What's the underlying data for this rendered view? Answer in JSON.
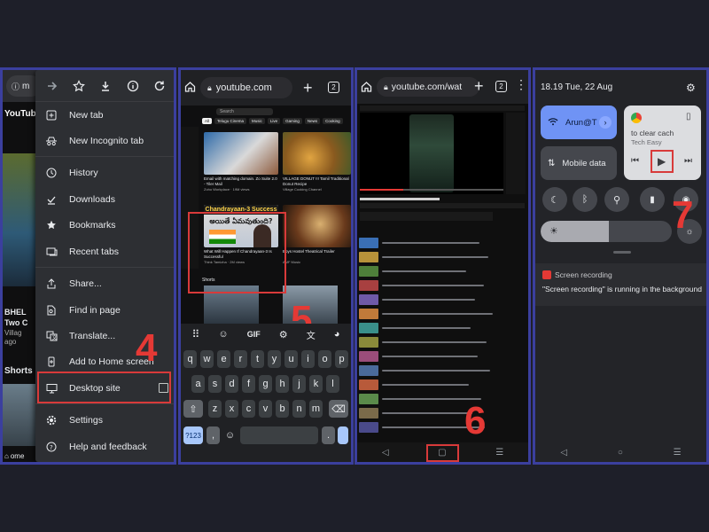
{
  "panel1": {
    "peek_text": {
      "url_fragment": "m",
      "yt": "YouTube",
      "bhel": "BHEL",
      "two": "Two C",
      "village": "Villag",
      "ago": "ago",
      "shorts": "Shorts",
      "home": "ome"
    },
    "menu_items": [
      {
        "label": "New tab",
        "icon": "new-tab-icon"
      },
      {
        "label": "New Incognito tab",
        "icon": "incognito-icon"
      },
      {
        "label": "History",
        "icon": "history-icon"
      },
      {
        "label": "Downloads",
        "icon": "download-done-icon"
      },
      {
        "label": "Bookmarks",
        "icon": "star-icon"
      },
      {
        "label": "Recent tabs",
        "icon": "recent-tabs-icon"
      },
      {
        "label": "Share...",
        "icon": "share-icon"
      },
      {
        "label": "Find in page",
        "icon": "find-in-page-icon"
      },
      {
        "label": "Translate...",
        "icon": "translate-icon"
      },
      {
        "label": "Add to Home screen",
        "icon": "add-to-home-icon"
      },
      {
        "label": "Desktop site",
        "icon": "desktop-icon"
      },
      {
        "label": "Settings",
        "icon": "settings-icon"
      },
      {
        "label": "Help and feedback",
        "icon": "help-icon"
      }
    ],
    "step": "4"
  },
  "panel2": {
    "url": "youtube.com",
    "tab_count": "2",
    "search_placeholder": "Search",
    "chips": [
      "All",
      "Telugu Cinema",
      "Music",
      "Live",
      "Gaming",
      "News",
      "Cooking"
    ],
    "video1_title": "Email with matching domain. Zo Suite 2.0 - Tiler Mail",
    "video1_meta": "Zoho Workplace · 19M views",
    "video2_title": "VILLAGE DONUT !!! Tamil Traditional Donut Recipe",
    "video2_meta": "Village Cooking Channel",
    "highlight_title": "Chandrayaan-3 Success",
    "highlight_telugu": "అయితే ఏమవుతుంది?",
    "highlight_video_title": "What Will Happen If Chandrayaan-3 Is Successful",
    "highlight_meta": "Think Tamizha · 2M views",
    "video4_title": "Boys Hostel Theatrical Trailer",
    "video4_meta": "AMF Music",
    "shorts_label": "Shorts",
    "keyboard_row1": [
      "q",
      "w",
      "e",
      "r",
      "t",
      "y",
      "u",
      "i",
      "o",
      "p"
    ],
    "keyboard_row2": [
      "a",
      "s",
      "d",
      "f",
      "g",
      "h",
      "j",
      "k",
      "l"
    ],
    "keyboard_row3": [
      "z",
      "x",
      "c",
      "v",
      "b",
      "n",
      "m"
    ],
    "key_gif": "GIF",
    "key_123": "?123",
    "key_comma": ",",
    "key_period": ".",
    "step": "5"
  },
  "panel3": {
    "url": "youtube.com/wat",
    "tab_count": "2",
    "step": "6"
  },
  "panel4": {
    "time": "18.19",
    "date": "Tue, 22 Aug",
    "wifi_label": "Arun@T",
    "mobile_data_label": "Mobile data",
    "media_hint": "to clear cach",
    "media_source": "Tech Easy",
    "notif_app": "Screen recording",
    "notif_body": "\"Screen recording\" is running in the background",
    "step": "7"
  },
  "colors": {
    "accent_red": "#e53935",
    "panel_border": "#3b3f9e",
    "qs_blue": "#6f93f5"
  }
}
